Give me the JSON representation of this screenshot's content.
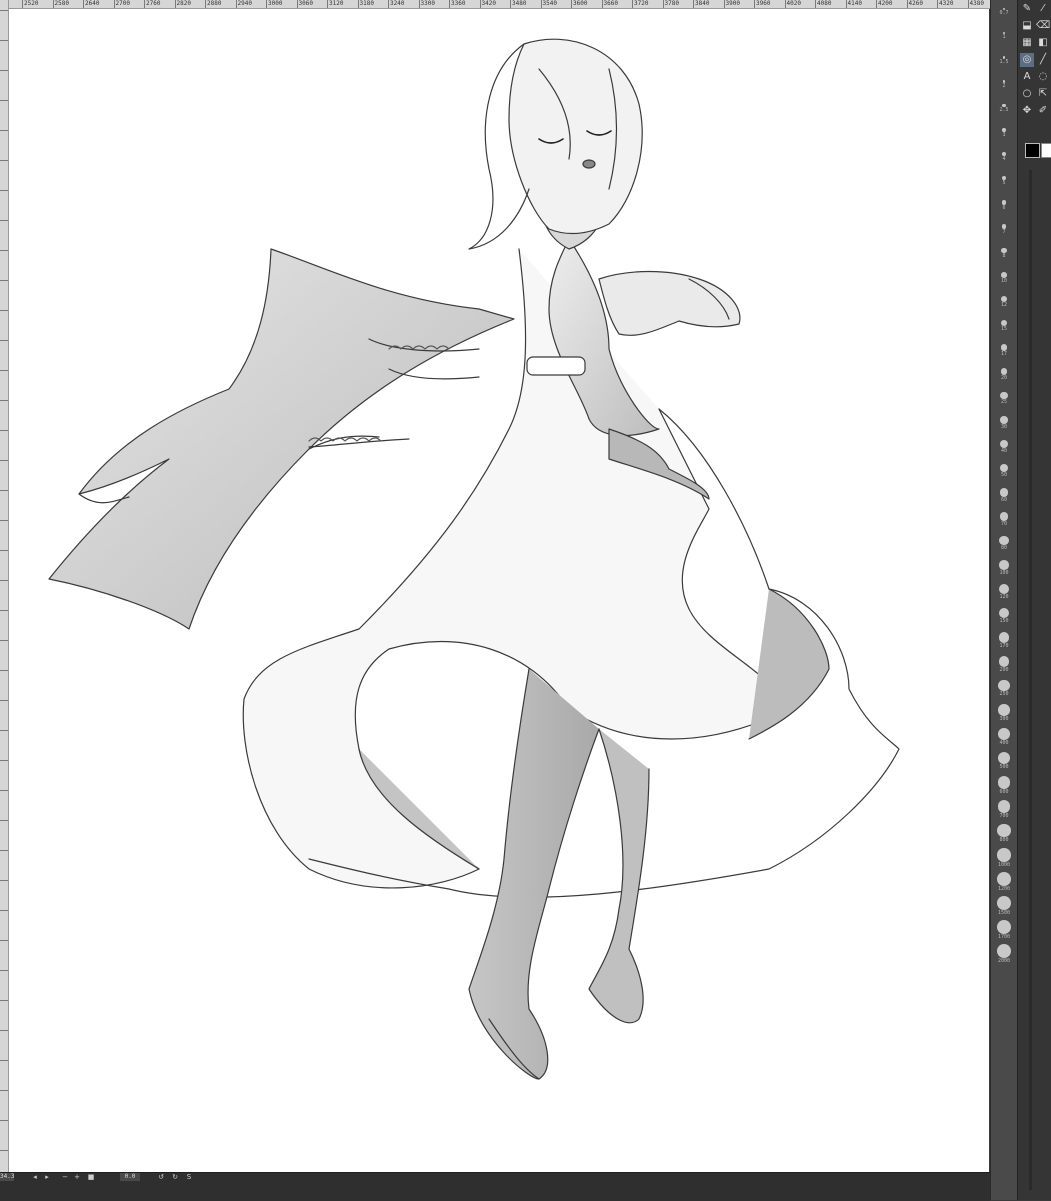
{
  "ruler": {
    "top_ticks": [
      "2520",
      "2580",
      "2640",
      "2700",
      "2760",
      "2820",
      "2880",
      "2940",
      "3000",
      "3060",
      "3120",
      "3180",
      "3240",
      "3300",
      "3360",
      "3420",
      "3480",
      "3540",
      "3600",
      "3660",
      "3720",
      "3780",
      "3840",
      "3900",
      "3960",
      "4020",
      "4080",
      "4140",
      "4200",
      "4260",
      "4320",
      "4380"
    ]
  },
  "status": {
    "zoom_value": "34.3",
    "angle_value": "0.0",
    "buttons": [
      "◂",
      "▸",
      "−",
      "+",
      "■",
      "↺",
      "↻",
      "S"
    ]
  },
  "brush_sizes": [
    "0.7",
    "1",
    "1.5",
    "2",
    "2.5",
    "3",
    "4",
    "5",
    "6",
    "7",
    "8",
    "10",
    "12",
    "15",
    "17",
    "20",
    "25",
    "30",
    "40",
    "50",
    "60",
    "70",
    "80",
    "100",
    "120",
    "150",
    "170",
    "200",
    "250",
    "300",
    "400",
    "500",
    "600",
    "700",
    "800",
    "1000",
    "1200",
    "1500",
    "1700",
    "2000"
  ],
  "tools": [
    {
      "icon": "pen-icon",
      "glyph": "✎"
    },
    {
      "icon": "brush-icon",
      "glyph": "⁄"
    },
    {
      "icon": "fill-icon",
      "glyph": "⬓"
    },
    {
      "icon": "eraser-icon",
      "glyph": "⌫"
    },
    {
      "icon": "layer-icon",
      "glyph": "▦"
    },
    {
      "icon": "gradient-icon",
      "glyph": "◧"
    },
    {
      "icon": "blend-icon",
      "glyph": "◎"
    },
    {
      "icon": "line-icon",
      "glyph": "╱"
    },
    {
      "icon": "text-icon",
      "glyph": "A"
    },
    {
      "icon": "balloon-icon",
      "glyph": "◌"
    },
    {
      "icon": "lasso-icon",
      "glyph": "○"
    },
    {
      "icon": "select-icon",
      "glyph": "⇱"
    },
    {
      "icon": "move-icon",
      "glyph": "✥"
    },
    {
      "icon": "eyedropper-icon",
      "glyph": "✐"
    }
  ],
  "colors": {
    "main": "#000000",
    "sub": "#ffffff",
    "ui_dark": "#353535",
    "canvas": "#ffffff"
  }
}
